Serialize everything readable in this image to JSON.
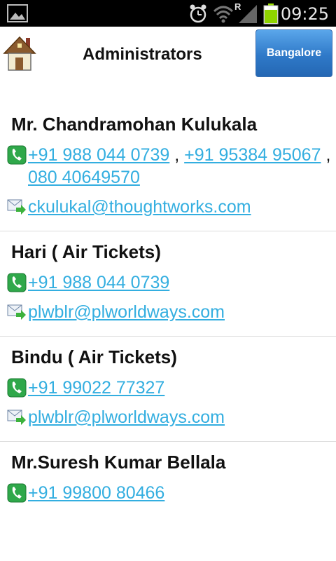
{
  "status_bar": {
    "time": "09:25",
    "roaming": "R",
    "icons": [
      "image-icon",
      "alarm-icon",
      "wifi-icon",
      "signal-icon",
      "battery-icon"
    ]
  },
  "header": {
    "title": "Administrators",
    "city_button": "Bangalore",
    "home_icon": "home-icon"
  },
  "contacts": [
    {
      "name": "Mr. Chandramohan Kulukala",
      "phones": [
        "+91 988 044 0739",
        "+91 95384 95067",
        "080 40649570"
      ],
      "email": "ckulukal@thoughtworks.com"
    },
    {
      "name": "Hari ( Air Tickets)",
      "phones": [
        "+91 988 044 0739"
      ],
      "email": "plwblr@plworldways.com"
    },
    {
      "name": "Bindu ( Air Tickets)",
      "phones": [
        "+91 99022 77327"
      ],
      "email": "plwblr@plworldways.com"
    },
    {
      "name": "Mr.Suresh Kumar Bellala",
      "phones": [
        "+91 99800 80466"
      ],
      "email": ""
    }
  ],
  "separator": ","
}
